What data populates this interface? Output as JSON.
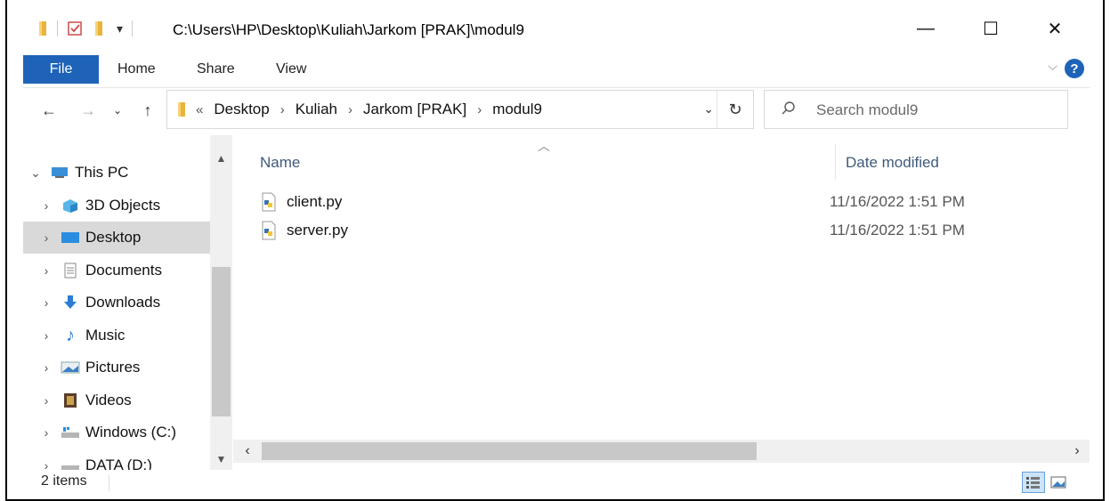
{
  "window": {
    "title": "C:\\Users\\HP\\Desktop\\Kuliah\\Jarkom [PRAK]\\modul9",
    "minimize": "—",
    "maximize": "☐",
    "close": "✕"
  },
  "ribbon": {
    "tabs": [
      "File",
      "Home",
      "Share",
      "View"
    ],
    "help": "?"
  },
  "address": {
    "prefix": "«",
    "crumbs": [
      "Desktop",
      "Kuliah",
      "Jarkom [PRAK]",
      "modul9"
    ],
    "separator": "›"
  },
  "search": {
    "placeholder": "Search modul9"
  },
  "nav_pane": {
    "items": [
      {
        "label": "This PC",
        "icon": "this-pc-icon",
        "expanded": true
      },
      {
        "label": "3D Objects",
        "icon": "3d-objects-icon"
      },
      {
        "label": "Desktop",
        "icon": "desktop-icon",
        "selected": true
      },
      {
        "label": "Documents",
        "icon": "documents-icon"
      },
      {
        "label": "Downloads",
        "icon": "downloads-icon"
      },
      {
        "label": "Music",
        "icon": "music-icon"
      },
      {
        "label": "Pictures",
        "icon": "pictures-icon"
      },
      {
        "label": "Videos",
        "icon": "videos-icon"
      },
      {
        "label": "Windows (C:)",
        "icon": "drive-c-icon"
      },
      {
        "label": "DATA (D:)",
        "icon": "drive-d-icon"
      }
    ]
  },
  "file_list": {
    "columns": [
      "Name",
      "Date modified"
    ],
    "rows": [
      {
        "name": "client.py",
        "date": "11/16/2022 1:51 PM",
        "icon": "python-file-icon"
      },
      {
        "name": "server.py",
        "date": "11/16/2022 1:51 PM",
        "icon": "python-file-icon"
      }
    ]
  },
  "status": {
    "count": "2 items"
  },
  "colors": {
    "accent": "#1e63b8",
    "selection": "#d9d9d9",
    "header_text": "#3f5a7a"
  }
}
